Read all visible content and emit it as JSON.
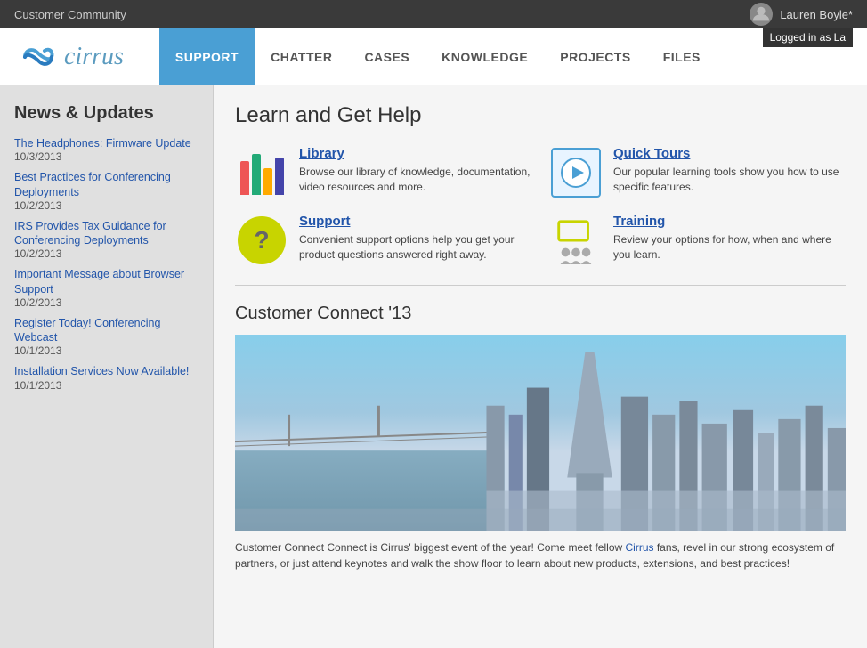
{
  "topbar": {
    "site_name": "Customer Community",
    "user_name": "Lauren Boyle*",
    "tooltip": "Logged in as La"
  },
  "nav": {
    "logo_text": "cirrus",
    "links": [
      {
        "id": "support",
        "label": "SUPPORT",
        "active": true
      },
      {
        "id": "chatter",
        "label": "CHATTER",
        "active": false
      },
      {
        "id": "cases",
        "label": "CASES",
        "active": false
      },
      {
        "id": "knowledge",
        "label": "KNOWLEDGE",
        "active": false
      },
      {
        "id": "projects",
        "label": "PROJECTS",
        "active": false
      },
      {
        "id": "files",
        "label": "FILES",
        "active": false
      }
    ]
  },
  "sidebar": {
    "heading": "News & Updates",
    "items": [
      {
        "title": "The Headphones: Firmware Update",
        "date": "10/3/2013"
      },
      {
        "title": "Best Practices for Conferencing Deployments",
        "date": "10/2/2013"
      },
      {
        "title": "IRS Provides Tax Guidance for Conferencing Deployments",
        "date": "10/2/2013"
      },
      {
        "title": "Important Message about Browser Support",
        "date": "10/2/2013"
      },
      {
        "title": "Register Today! Conferencing Webcast",
        "date": "10/1/2013"
      },
      {
        "title": "Installation Services Now Available!",
        "date": "10/1/2013"
      }
    ]
  },
  "main": {
    "heading": "Learn and Get Help",
    "help_items": [
      {
        "id": "library",
        "title": "Library",
        "description": "Browse our library of knowledge, documentation, video resources and more."
      },
      {
        "id": "quick-tours",
        "title": "Quick Tours",
        "description": "Our popular learning tools show you how to use specific features."
      },
      {
        "id": "support",
        "title": "Support",
        "description": "Convenient support options help you get your product questions answered right away."
      },
      {
        "id": "training",
        "title": "Training",
        "description": "Review your options for how, when and where you learn."
      }
    ],
    "customer_connect": {
      "heading": "Customer Connect '13",
      "caption": "Customer Connect Connect is Cirrus' biggest event of the year! Come meet fellow Cirrus fans, revel in our strong ecosystem of partners, or just attend keynotes and walk the show floor to learn about new products, extensions, and best practices!"
    }
  },
  "colors": {
    "accent_blue": "#4a9fd4",
    "nav_active": "#4a9fd4",
    "logo_blue": "#5b9bbf",
    "link_color": "#2255aa",
    "library_bar1": "#e55",
    "library_bar2": "#2a7",
    "library_bar3": "#fa0",
    "library_bar4": "#44a",
    "support_bg": "#c8d400"
  }
}
